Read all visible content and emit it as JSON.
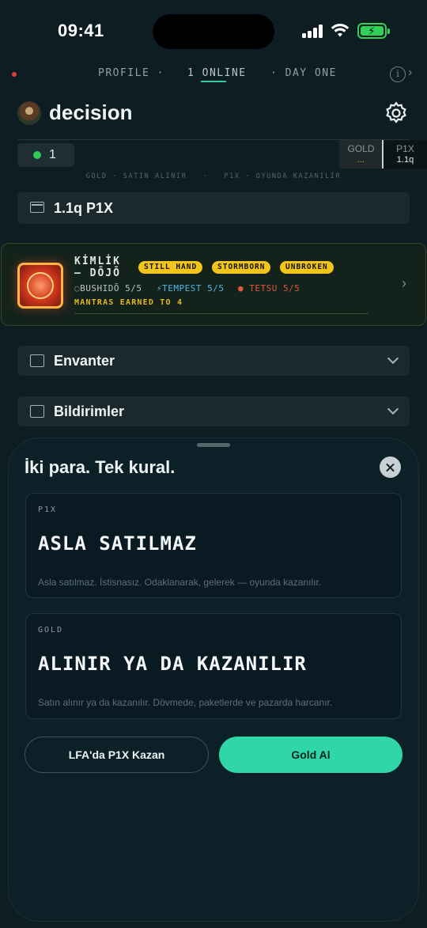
{
  "status_bar": {
    "time": "09:41"
  },
  "topnav": {
    "profile": "PROFILE ·",
    "online": "1 ONLINE",
    "day": "· DAY ONE"
  },
  "header": {
    "title": "decision"
  },
  "online_count": "1",
  "balances": {
    "gold_label": "GOLD",
    "gold_value": "...",
    "p1x_label": "P1X",
    "p1x_value": "1.1q"
  },
  "subline": "GOLD · SATIN ALINIR   ·   P1X · OYUNDA KAZANILIR",
  "wallet": {
    "amount": "1.1q P1X"
  },
  "identity": {
    "title_line1": "KİMLİK",
    "title_line2": "— DŌJŌ",
    "tags": [
      "STILL HAND",
      "STORMBORN",
      "UNBROKEN"
    ],
    "stats": [
      {
        "label": "BUSHIDŌ 5/5",
        "color": "#b9c4c8",
        "icon": "ring-icon"
      },
      {
        "label": "TEMPEST 5/5",
        "color": "#4fb6e6",
        "icon": "bolt-icon"
      },
      {
        "label": "TETSU 5/5",
        "color": "#e0583c",
        "icon": "dot-icon"
      }
    ],
    "mantras": "MANTRAS EARNED TO 4"
  },
  "accordions": {
    "inventory": "Envanter",
    "notifications": "Bildirimler"
  },
  "sheet": {
    "title": "İki para. Tek kural.",
    "cards": [
      {
        "kicker": "P1X",
        "headline": "ASLA SATILMAZ",
        "desc": "Asla satılmaz. İstisnasız. Odaklanarak, gelerek — oyunda kazanılır."
      },
      {
        "kicker": "GOLD",
        "headline": "ALINIR YA DA KAZANILIR",
        "desc": "Satın alınır ya da kazanılır. Dövmede, paketlerde ve pazarda harcanır."
      }
    ],
    "btn_earn": "LFA'da P1X Kazan",
    "btn_buy": "Gold Al"
  },
  "colors": {
    "accent": "#2ed6a9",
    "tag": "#f2c518",
    "gold": "#e5a829",
    "online": "#34c759"
  }
}
